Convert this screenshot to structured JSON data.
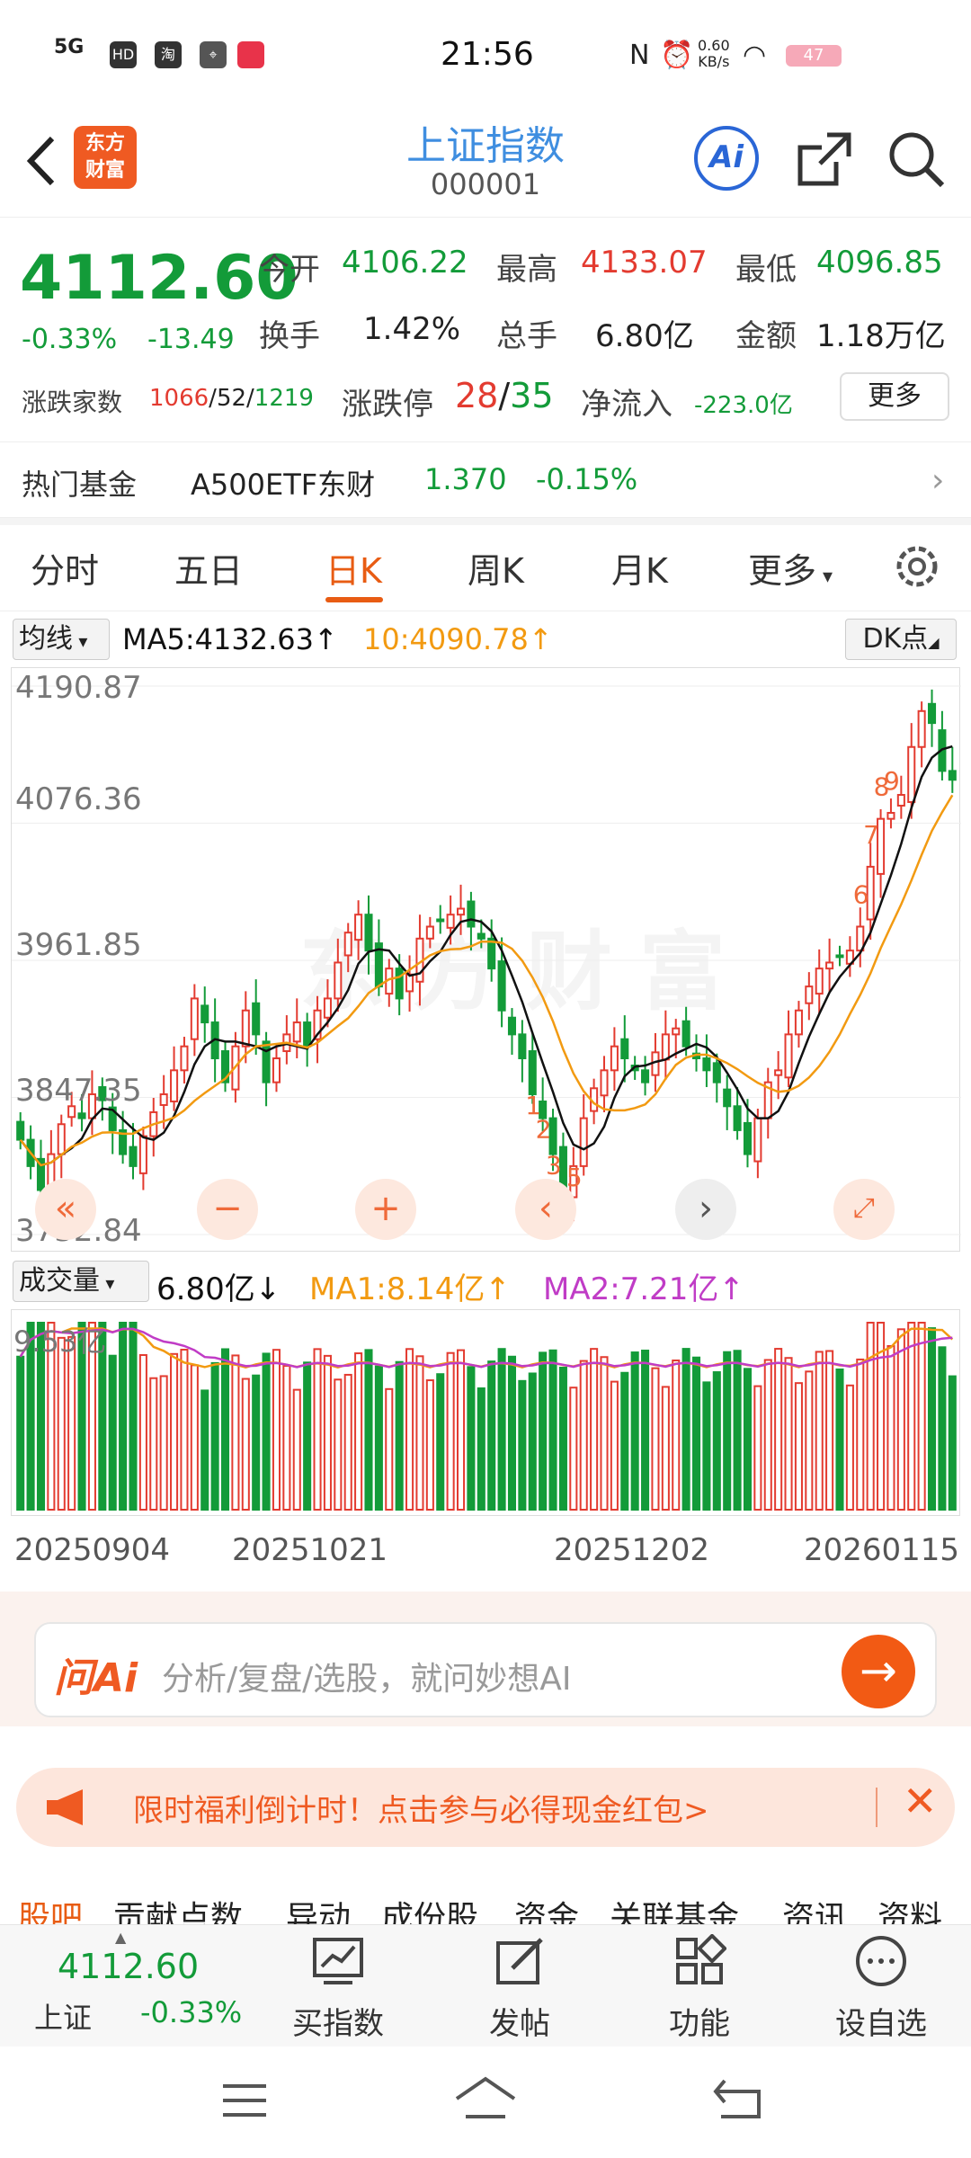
{
  "status_bar": {
    "time": "21:56",
    "network": "5G",
    "speed_value": "0.60",
    "speed_unit": "KB/s",
    "battery": "47",
    "icon_hd": "HD",
    "icon_taobao": "淘"
  },
  "header": {
    "title": "上证指数",
    "code": "000001",
    "logo_line1": "东方",
    "logo_line2": "财富",
    "ai_label": "Ai"
  },
  "quote": {
    "price": "4112.60",
    "change_pct": "-0.33%",
    "change_abs": "-13.49",
    "open_label": "今开",
    "open": "4106.22",
    "high_label": "最高",
    "high": "4133.07",
    "low_label": "最低",
    "low": "4096.85",
    "turnover_label": "换手",
    "turnover": "1.42%",
    "volume_label": "总手",
    "volume": "6.80亿",
    "amount_label": "金额",
    "amount": "1.18万亿",
    "breadth_label": "涨跌家数",
    "breadth_up": "1066",
    "breadth_flat": "52",
    "breadth_down": "1219",
    "limit_label": "涨跌停",
    "limit_up": "28",
    "limit_down": "35",
    "netflow_label": "净流入",
    "netflow": "-223.0亿",
    "more_label": "更多"
  },
  "fund": {
    "label": "热门基金",
    "name": "A500ETF东财",
    "price": "1.370",
    "pct": "-0.15%"
  },
  "tabs": [
    {
      "label": "分时"
    },
    {
      "label": "五日"
    },
    {
      "label": "日K"
    },
    {
      "label": "周K"
    },
    {
      "label": "月K"
    },
    {
      "label": "更多"
    }
  ],
  "indicator": {
    "selector": "均线",
    "ma5": "MA5:4132.63↑",
    "ma10": "10:4090.78↑",
    "dk_label": "DK点"
  },
  "price_axis": [
    "4190.87",
    "4076.36",
    "3961.85",
    "3847.35",
    "3732.84"
  ],
  "watermark": "东方财富",
  "volume": {
    "selector": "成交量",
    "value": "6.80亿↓",
    "ma1": "MA1:8.14亿↑",
    "ma2": "MA2:7.21亿↑",
    "max_label": "9.53亿"
  },
  "dates": [
    "20250904",
    "20251021",
    "20251202",
    "20260115"
  ],
  "ai_search": {
    "brand": "问Ai",
    "placeholder": "分析/复盘/选股，就问妙想AI"
  },
  "promo": {
    "text": "限时福利倒计时！点击参与必得现金红包>"
  },
  "sub_tabs": [
    "股吧",
    "贡献点数",
    "异动",
    "成份股",
    "资金",
    "关联基金",
    "资讯",
    "资料"
  ],
  "bottom_bar": {
    "price": "4112.60",
    "name": "上证",
    "pct": "-0.33%",
    "items": [
      {
        "label": "买指数"
      },
      {
        "label": "发帖"
      },
      {
        "label": "功能"
      },
      {
        "label": "设自选"
      }
    ]
  },
  "colors": {
    "up": "#e33b30",
    "down": "#139b39",
    "accent": "#e85c13",
    "ma5": "#111111",
    "ma10": "#f29a11",
    "ma2": "#c03cc6"
  },
  "chart_data": {
    "type": "candlestick",
    "x_range_dates": [
      "20250904",
      "20260115"
    ],
    "ylim": [
      3732.84,
      4190.87
    ],
    "y_ticks": [
      4190.87,
      4076.36,
      3961.85,
      3847.35,
      3732.84
    ],
    "closes": [
      3812,
      3790,
      3770,
      3800,
      3825,
      3840,
      3830,
      3850,
      3845,
      3820,
      3800,
      3790,
      3815,
      3835,
      3850,
      3870,
      3890,
      3930,
      3910,
      3880,
      3860,
      3890,
      3920,
      3900,
      3860,
      3880,
      3900,
      3910,
      3890,
      3920,
      3930,
      3960,
      3985,
      4000,
      3970,
      3940,
      3955,
      3930,
      3950,
      3980,
      3990,
      3995,
      4000,
      4005,
      3990,
      3980,
      3955,
      3920,
      3900,
      3880,
      3850,
      3830,
      3800,
      3770,
      3790,
      3830,
      3855,
      3870,
      3890,
      3880,
      3870,
      3860,
      3885,
      3900,
      3905,
      3890,
      3880,
      3870,
      3860,
      3840,
      3820,
      3800,
      3830,
      3860,
      3870,
      3900,
      3920,
      3940,
      3955,
      3960,
      3965,
      3970,
      3990,
      4040,
      4080,
      4085,
      4100,
      4140,
      4170,
      4160,
      4120,
      4112.6
    ],
    "ma5_last": 4132.63,
    "ma10_last": 4090.78,
    "volume_max": 9.53,
    "volume_last": 6.8,
    "volume_ma1_last": 8.14,
    "volume_ma2_last": 7.21,
    "signals": [
      "1",
      "2",
      "3",
      "4",
      "5",
      "6",
      "7",
      "8",
      "9"
    ]
  }
}
